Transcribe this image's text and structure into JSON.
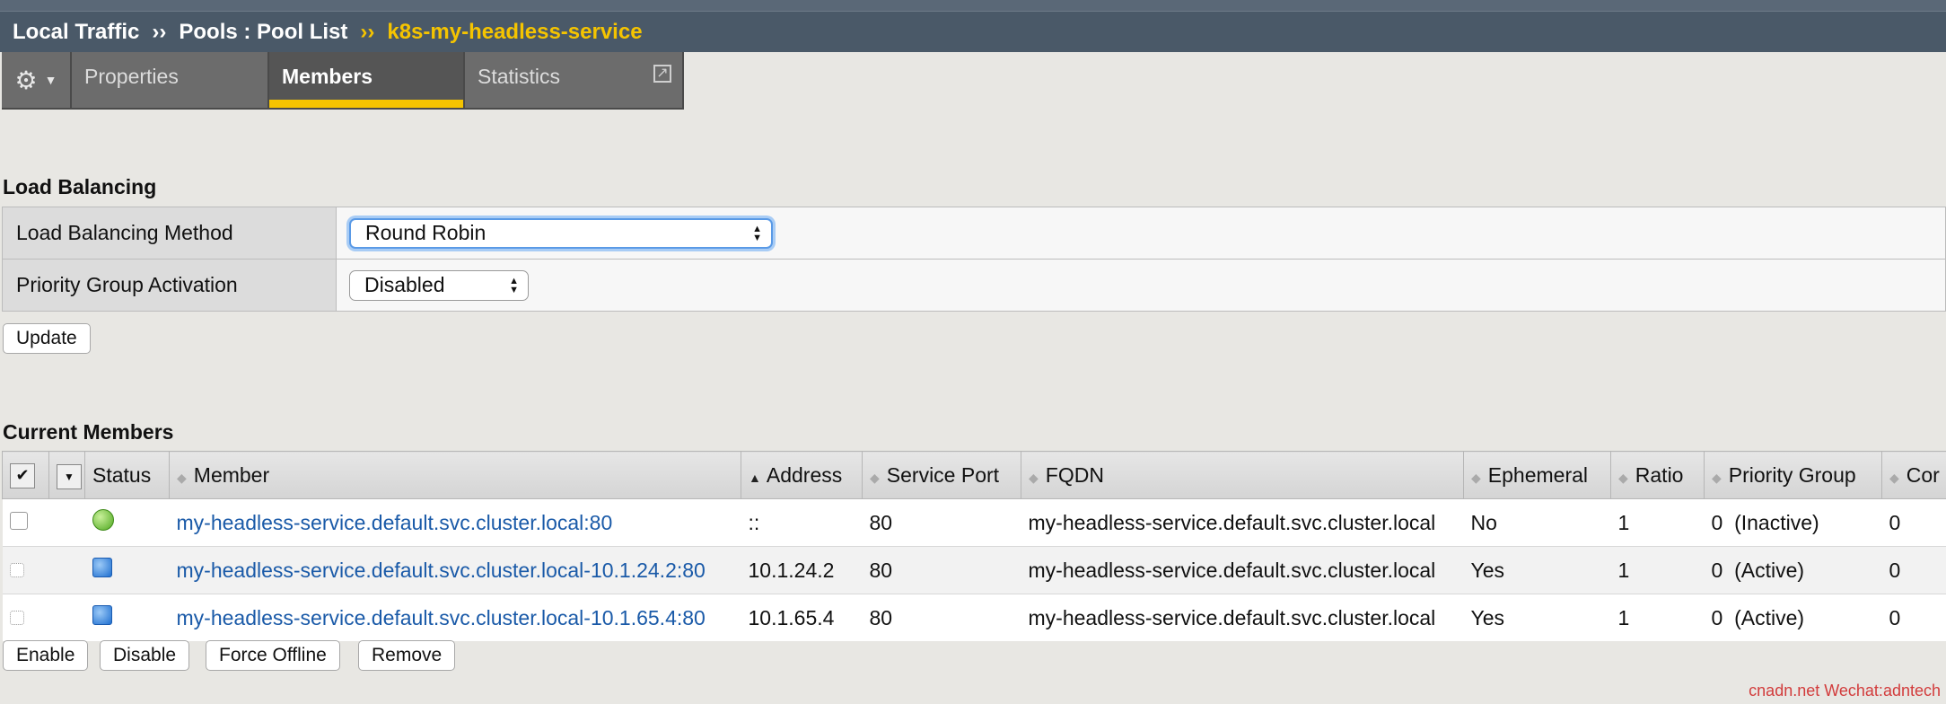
{
  "breadcrumb": {
    "part1": "Local Traffic",
    "sep1": "››",
    "part2": "Pools : Pool List",
    "sep2": "››",
    "current": "k8s-my-headless-service"
  },
  "tabs": {
    "properties": "Properties",
    "members": "Members",
    "statistics": "Statistics"
  },
  "load_balancing": {
    "title": "Load Balancing",
    "method_label": "Load Balancing Method",
    "method_value": "Round Robin",
    "priority_label": "Priority Group Activation",
    "priority_value": "Disabled",
    "update_button": "Update"
  },
  "current_members": {
    "title": "Current Members",
    "columns": {
      "status": "Status",
      "member": "Member",
      "address": "Address",
      "service_port": "Service Port",
      "fqdn": "FQDN",
      "ephemeral": "Ephemeral",
      "ratio": "Ratio",
      "priority_group": "Priority Group",
      "connection_limit": "Cor"
    },
    "rows": [
      {
        "status": "available",
        "member": "my-headless-service.default.svc.cluster.local:80",
        "address": "::",
        "port": "80",
        "fqdn": "my-headless-service.default.svc.cluster.local",
        "ephemeral": "No",
        "ratio": "1",
        "priority": "0",
        "priority_state": "(Inactive)",
        "limit": "0"
      },
      {
        "status": "unknown",
        "member": "my-headless-service.default.svc.cluster.local-10.1.24.2:80",
        "address": "10.1.24.2",
        "port": "80",
        "fqdn": "my-headless-service.default.svc.cluster.local",
        "ephemeral": "Yes",
        "ratio": "1",
        "priority": "0",
        "priority_state": "(Active)",
        "limit": "0"
      },
      {
        "status": "unknown",
        "member": "my-headless-service.default.svc.cluster.local-10.1.65.4:80",
        "address": "10.1.65.4",
        "port": "80",
        "fqdn": "my-headless-service.default.svc.cluster.local",
        "ephemeral": "Yes",
        "ratio": "1",
        "priority": "0",
        "priority_state": "(Active)",
        "limit": "0"
      }
    ],
    "buttons": {
      "enable": "Enable",
      "disable": "Disable",
      "force_offline": "Force Offline",
      "remove": "Remove"
    }
  },
  "watermark": "cnadn.net Wechat:adntech",
  "colors": {
    "header_bg": "#4a5968",
    "accent_gold": "#f5c400",
    "link_blue": "#1a5aa8",
    "status_available": "#4ea81f",
    "status_unknown": "#1f6fd0"
  }
}
